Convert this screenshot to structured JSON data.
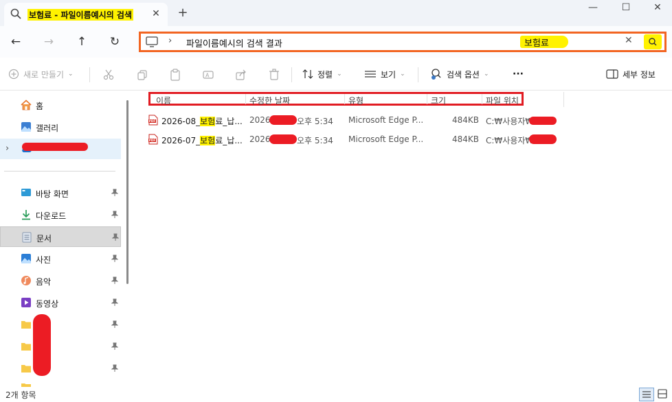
{
  "tab": {
    "title": "보험료 - 파일이름예시의 검색",
    "close_glyph": "✕",
    "new_tab_glyph": "+"
  },
  "window": {
    "minimize_glyph": "—",
    "maximize_glyph": "☐",
    "close_glyph": "✕"
  },
  "nav": {
    "back_glyph": "←",
    "forward_glyph": "→",
    "up_glyph": "↑",
    "refresh_glyph": "↻"
  },
  "address": {
    "separator": "›",
    "breadcrumb": "파일이름예시의 검색 결과",
    "search_query": "보험료",
    "clear_glyph": "✕"
  },
  "commands": {
    "new": "새로 만들기",
    "sort": "정렬",
    "view": "보기",
    "search_options": "검색 옵션",
    "more": "···",
    "details": "세부 정보"
  },
  "sidebar": {
    "home": "홈",
    "gallery": "갤러리",
    "desktop": "바탕 화면",
    "downloads": "다운로드",
    "documents": "문서",
    "pictures": "사진",
    "music": "음악",
    "videos": "동영상",
    "expand_glyph": "›"
  },
  "columns": {
    "name": "이름",
    "modified": "수정한 날짜",
    "type": "유형",
    "size": "크기",
    "location": "파일 위치"
  },
  "files": [
    {
      "name_prefix": "2026-08_",
      "name_match": "보험",
      "name_suffix": "료_납...",
      "modified_prefix": "2026",
      "modified_suffix": "오후 5:34",
      "type": "Microsoft Edge P...",
      "size": "484KB",
      "location": "C:₩사용자₩"
    },
    {
      "name_prefix": "2026-07_",
      "name_match": "보험",
      "name_suffix": "료_납...",
      "modified_prefix": "2026",
      "modified_suffix": "오후 5:34",
      "type": "Microsoft Edge P...",
      "size": "484KB",
      "location": "C:₩사용자₩"
    }
  ],
  "status": {
    "count": "2개 항목"
  },
  "colors": {
    "highlight": "#fff200",
    "address_border": "#f26522",
    "header_border": "#e11b22",
    "redaction": "#ec1c24"
  }
}
